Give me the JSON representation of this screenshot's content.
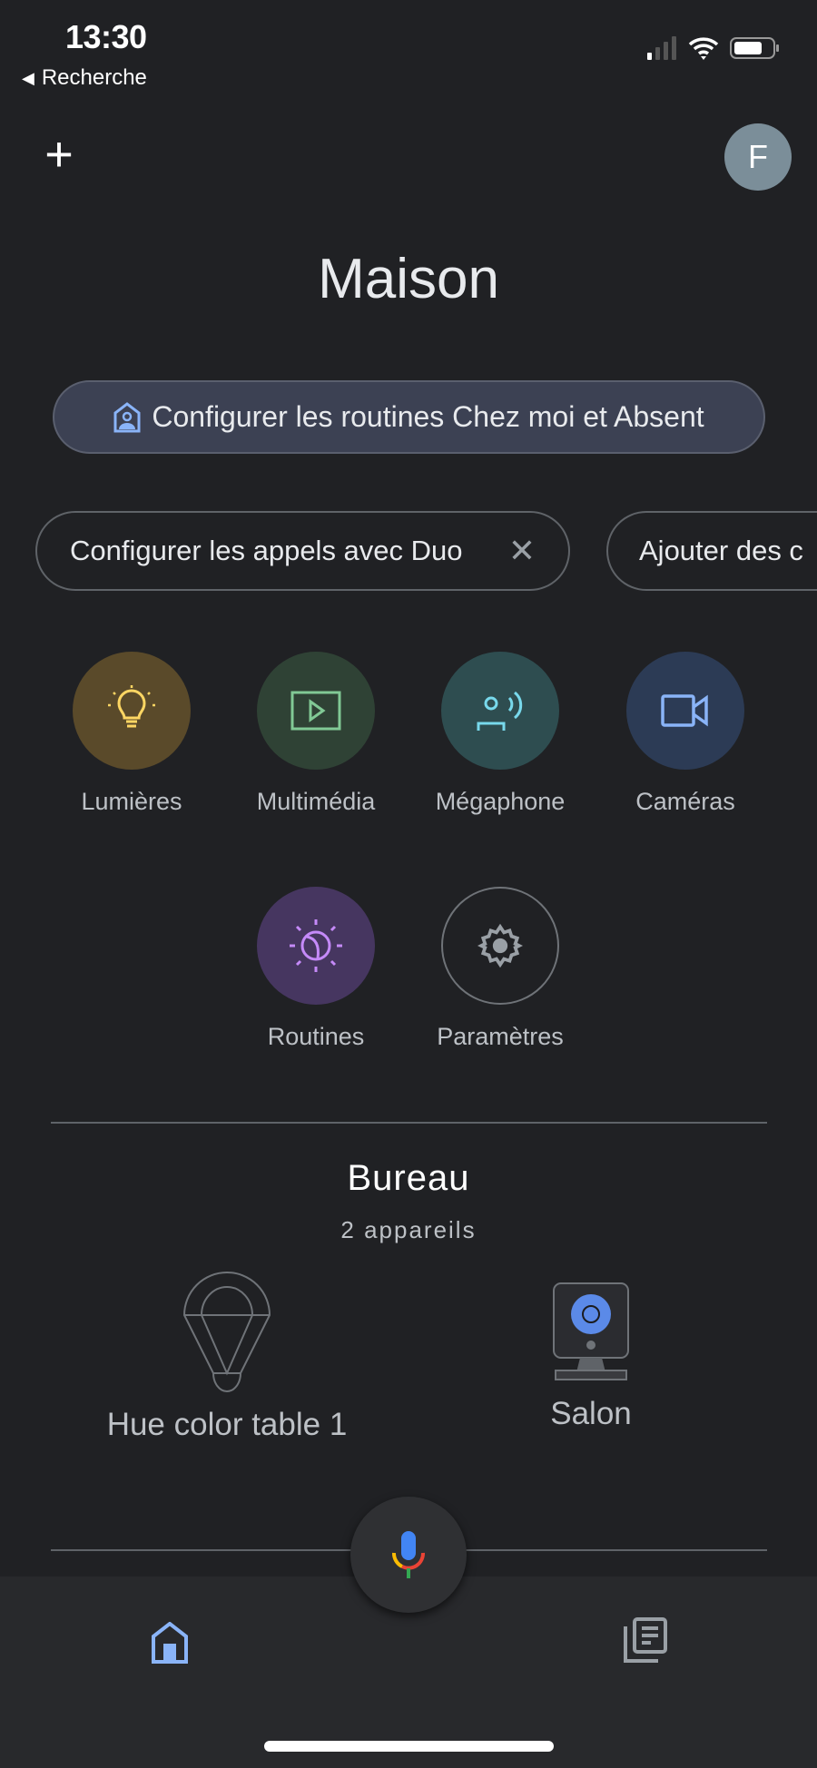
{
  "status_bar": {
    "time": "13:30",
    "back_label": "Recherche",
    "signal_bars": 1,
    "battery_percent": 75
  },
  "header": {
    "add_icon": "plus-icon",
    "avatar_initial": "F",
    "title": "Maison"
  },
  "routine_banner": {
    "label": "Configurer les routines Chez moi et Absent",
    "icon": "home-person-icon",
    "accent": "#8ab4f8"
  },
  "chips": [
    {
      "label": "Configurer les appels avec Duo",
      "dismiss_icon": "close-icon"
    },
    {
      "label": "Ajouter des c"
    }
  ],
  "shortcuts": [
    {
      "label": "Lumières",
      "icon": "lightbulb-icon",
      "bg": "#5a4a2a",
      "fg": "#fdd663"
    },
    {
      "label": "Multimédia",
      "icon": "play-icon",
      "bg": "#2f4235",
      "fg": "#81c995"
    },
    {
      "label": "Mégaphone",
      "icon": "broadcast-icon",
      "bg": "#2e4d50",
      "fg": "#78d9ec"
    },
    {
      "label": "Caméras",
      "icon": "video-camera-icon",
      "bg": "#2c3b55",
      "fg": "#8ab4f8"
    },
    {
      "label": "Routines",
      "icon": "routine-sun-moon-icon",
      "bg": "#463660",
      "fg": "#c58af9"
    },
    {
      "label": "Paramètres",
      "icon": "gear-icon",
      "bg": "transparent",
      "fg": "#9aa0a6"
    }
  ],
  "room": {
    "name": "Bureau",
    "device_count": "2 appareils",
    "devices": [
      {
        "name": "Hue color table 1",
        "icon": "bulb-outline-icon"
      },
      {
        "name": "Salon",
        "icon": "camera-device-icon"
      }
    ]
  },
  "bottom_nav": {
    "items": [
      {
        "icon": "home-icon",
        "active": true
      },
      {
        "icon": "feed-icon",
        "active": false
      }
    ],
    "mic_icon": "google-mic-icon"
  }
}
